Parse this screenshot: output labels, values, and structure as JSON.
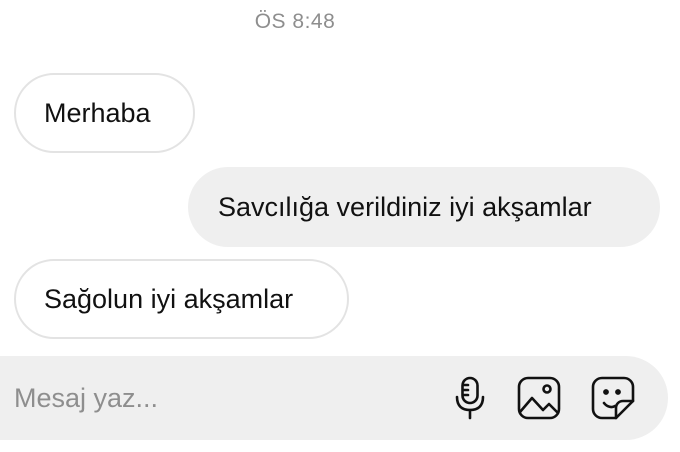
{
  "thread": {
    "timestamp": "ÖS 8:48",
    "messages": [
      {
        "direction": "incoming",
        "text": "Merhaba"
      },
      {
        "direction": "outgoing",
        "text": "Savcılığa verildiniz iyi akşamlar"
      },
      {
        "direction": "incoming",
        "text": "Sağolun iyi akşamlar"
      }
    ]
  },
  "composer": {
    "placeholder": "Mesaj yaz...",
    "icons": [
      "microphone-icon",
      "gallery-icon",
      "sticker-icon"
    ]
  },
  "colors": {
    "outgoing_bubble": "#efefef",
    "incoming_border": "#e3e3e3",
    "muted_text": "#8e8e8e"
  }
}
